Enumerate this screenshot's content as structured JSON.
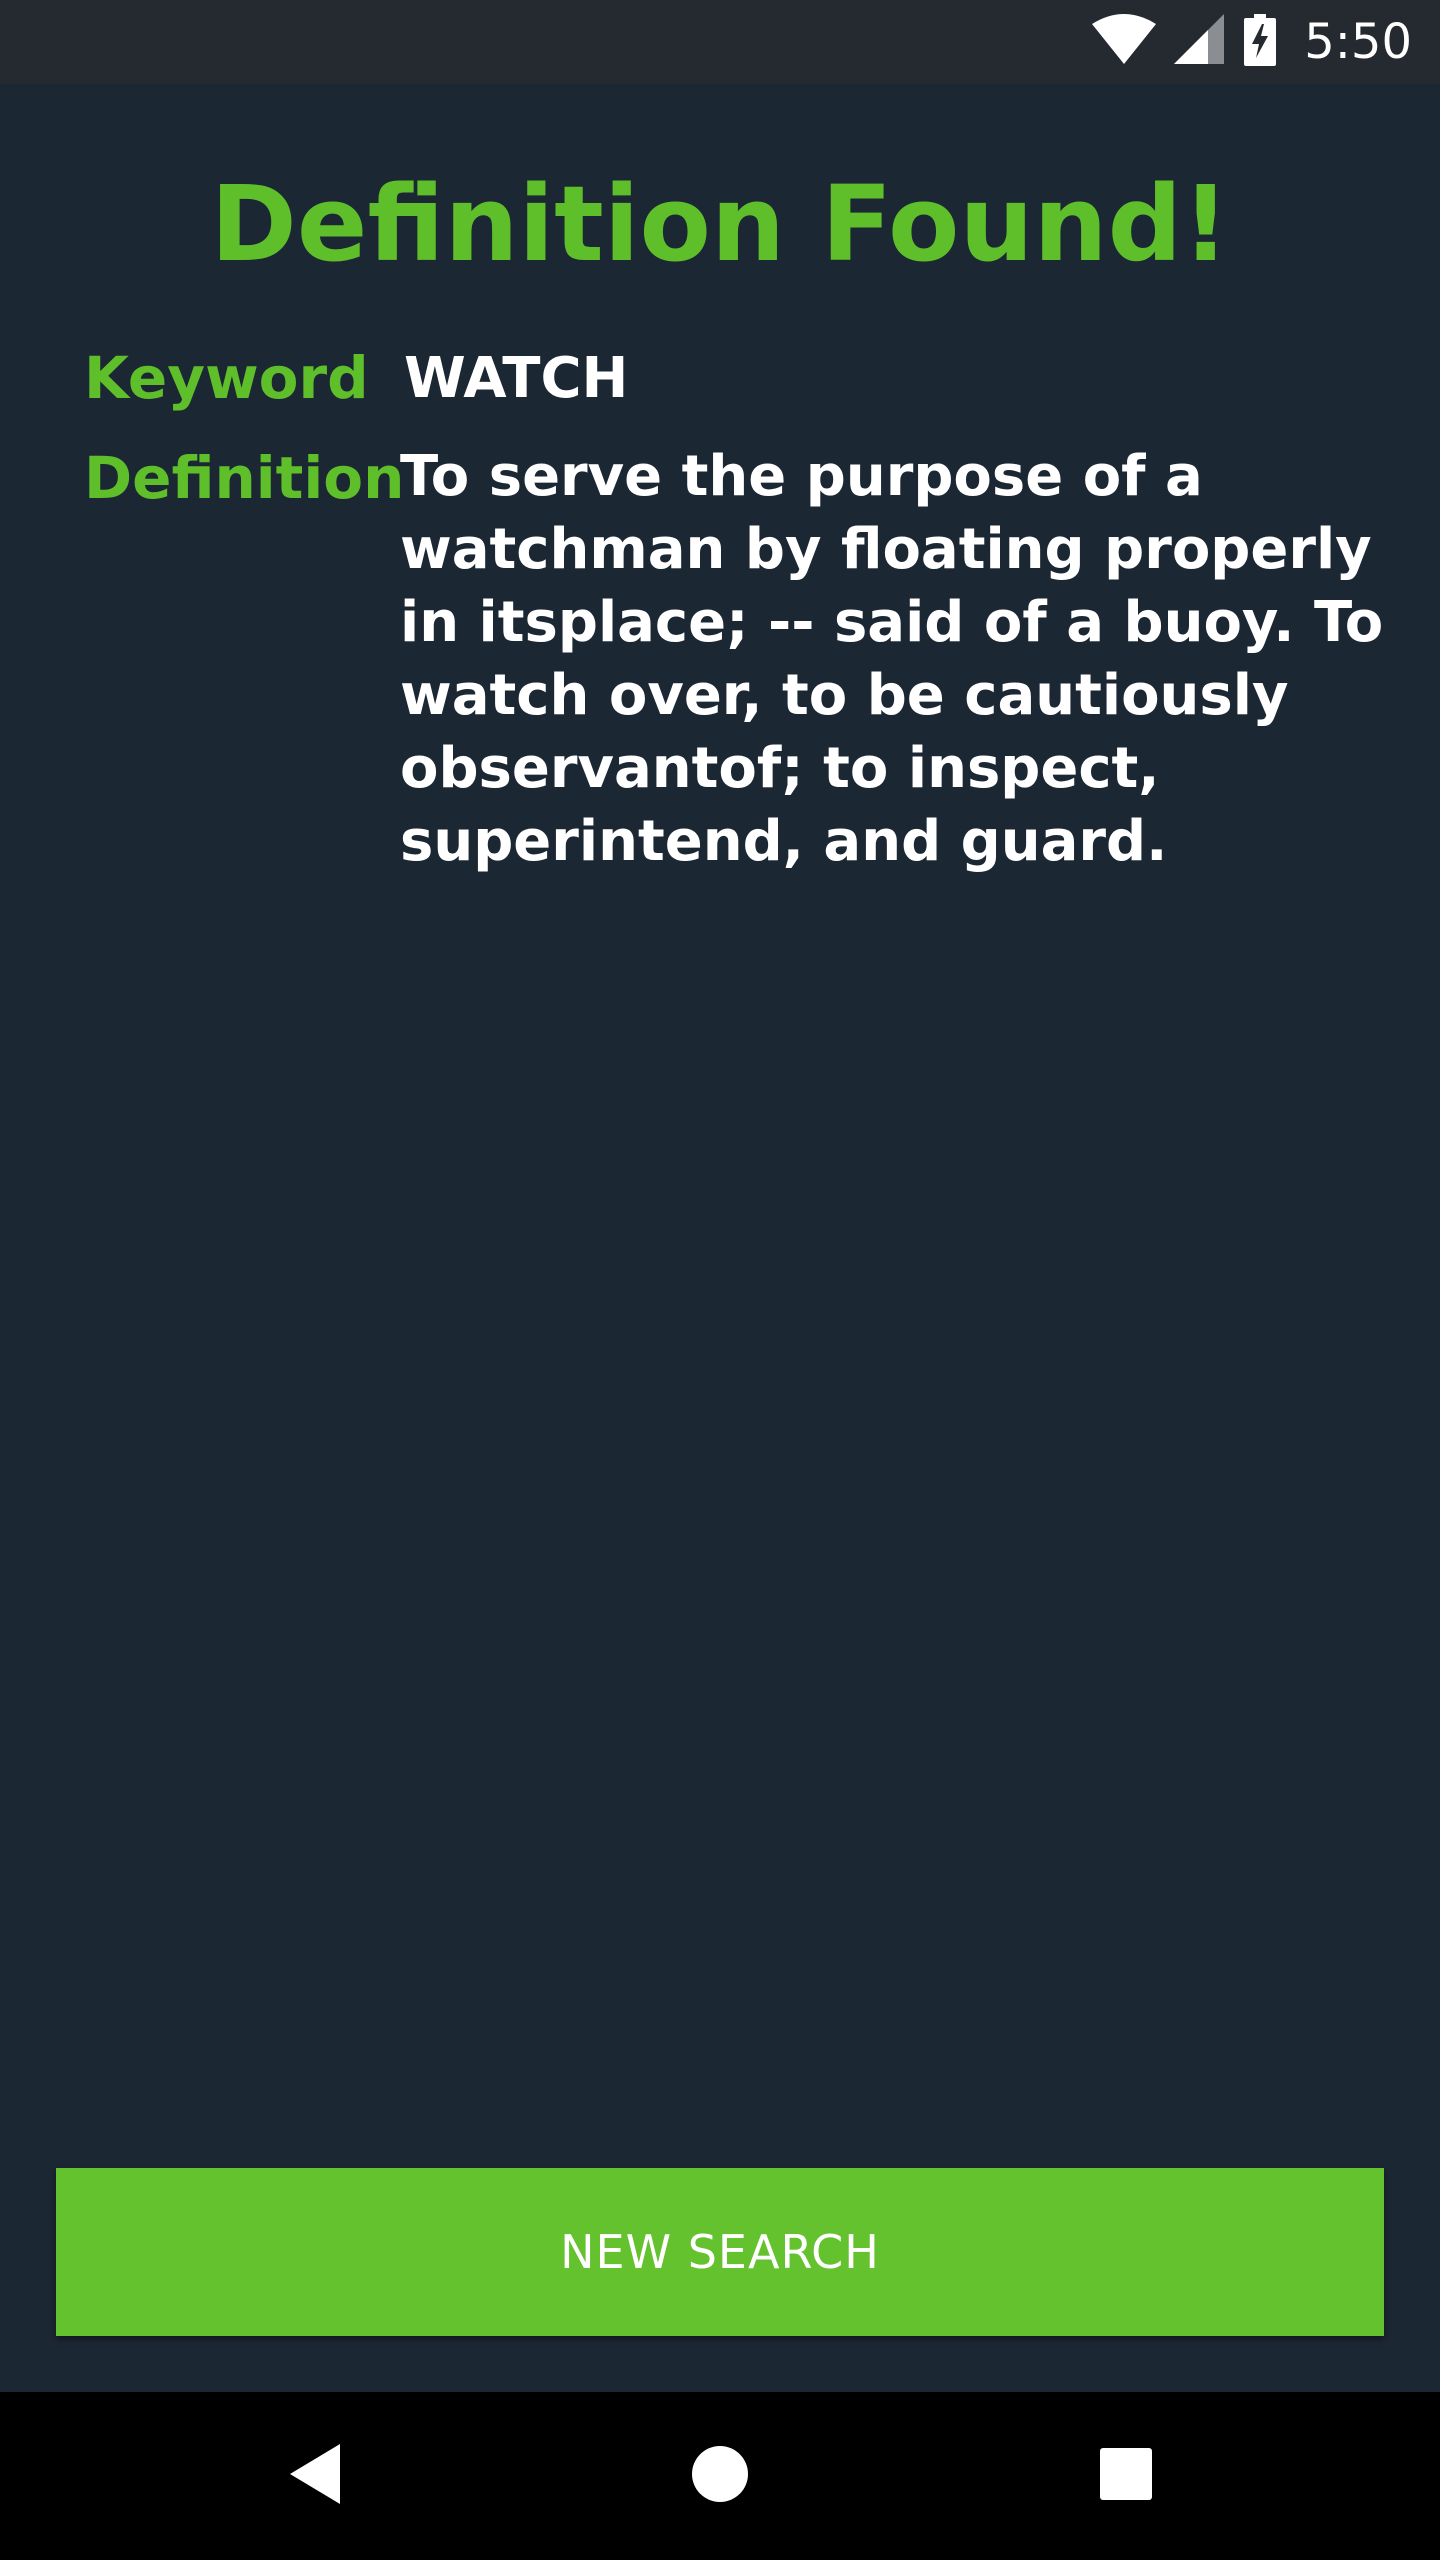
{
  "status_bar": {
    "time": "5:50",
    "icons": [
      "wifi-icon",
      "cell-signal-icon",
      "battery-charging-icon"
    ]
  },
  "page": {
    "title": "Definition Found!",
    "keyword_label": "Keyword",
    "keyword_value": "WATCH",
    "definition_label": "Definition",
    "definition_value": "To serve the purpose of a watchman by floating properly in itsplace; -- said of a buoy. To watch over, to be cautiously observantof; to inspect, superintend, and guard.",
    "button_label": "NEW SEARCH"
  },
  "nav_bar": {
    "icons": [
      "back-icon",
      "home-icon",
      "recents-icon"
    ]
  },
  "colors": {
    "background": "#1c2734",
    "accent": "#5fbf2b",
    "button": "#64c22e",
    "status_bar": "#252a30",
    "nav_bar": "#000000"
  }
}
